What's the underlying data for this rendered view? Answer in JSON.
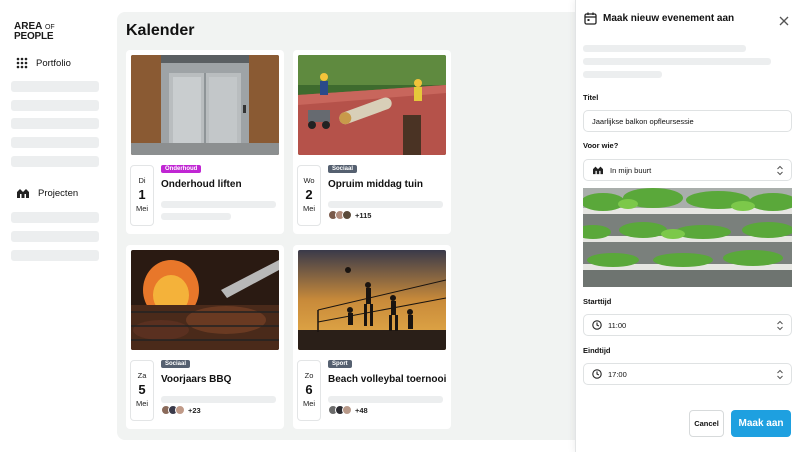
{
  "sidebar": {
    "logo": {
      "line1": "AREA",
      "line1_small": "OF",
      "line2": "PEOPLE"
    },
    "items": [
      {
        "label": "Portfolio",
        "icon": "grid-icon"
      },
      {
        "label": "Projecten",
        "icon": "buildings-icon"
      }
    ]
  },
  "main": {
    "title": "Kalender",
    "cards": [
      {
        "dow": "Di",
        "day": "1",
        "month": "Mei",
        "badge": "Onderhoud",
        "badge_color": "#c026d3",
        "title": "Onderhoud liften",
        "attendee_count": "",
        "image": "elevator"
      },
      {
        "dow": "Wo",
        "day": "2",
        "month": "Mei",
        "badge": "Sociaal",
        "badge_color": "#556070",
        "title": "Opruim middag tuin",
        "attendee_count": "+115",
        "image": "garden-workers"
      },
      {
        "dow": "Za",
        "day": "5",
        "month": "Mei",
        "badge": "Sociaal",
        "badge_color": "#556070",
        "title": "Voorjaars BBQ",
        "attendee_count": "+23",
        "image": "barbecue"
      },
      {
        "dow": "Zo",
        "day": "6",
        "month": "Mei",
        "badge": "Sport",
        "badge_color": "#556070",
        "title": "Beach volleybal toernooi",
        "attendee_count": "+48",
        "image": "beach-volleyball"
      }
    ]
  },
  "panel": {
    "title": "Maak nieuw evenement aan",
    "title_label": "Titel",
    "title_value": "Jaarlijkse balkon opfleursessie",
    "audience_label": "Voor wie?",
    "audience_value": "In mijn buurt",
    "start_label": "Starttijd",
    "start_value": "11:00",
    "end_label": "Eindtijd",
    "end_value": "17:00",
    "cancel_label": "Cancel",
    "submit_label": "Maak aan",
    "accent": "#1ea0e0"
  }
}
